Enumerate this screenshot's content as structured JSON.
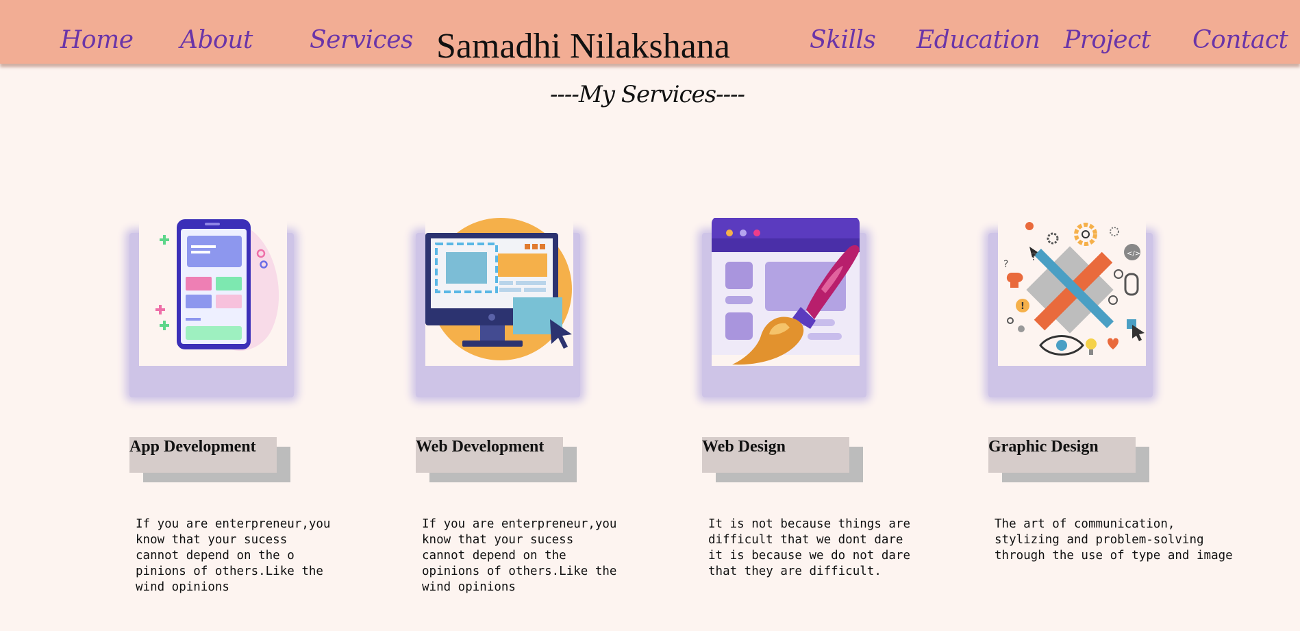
{
  "nav": {
    "brand": "Samadhi Nilakshana",
    "left_links": [
      "Home",
      "About",
      "Services"
    ],
    "right_links": [
      "Skills",
      "Education",
      "Project",
      "Contact"
    ]
  },
  "section_title": "----My Services----",
  "services": [
    {
      "title": "App Development",
      "image_icon": "mobile-app-illustration",
      "description": "If you are enterpreneur,you\nknow that your sucess\ncannot depend on the o\npinions of others.Like the\nwind opinions"
    },
    {
      "title": "Web Development",
      "image_icon": "desktop-monitor-illustration",
      "description": "If you are enterpreneur,you\nknow that your sucess\ncannot depend on the\nopinions of others.Like the\nwind opinions"
    },
    {
      "title": "Web Design",
      "image_icon": "paint-brush-browser-illustration",
      "description": "It is not because things are\ndifficult that we dont dare\nit is because we do not dare\nthat they are difficult."
    },
    {
      "title": "Graphic Design",
      "image_icon": "design-tools-illustration",
      "description": "The art of communication,\nstylizing and problem-solving\nthrough the use of type and image"
    }
  ],
  "colors": {
    "navbar": "#f2ad94",
    "nav_link": "#6a35a8",
    "page_bg": "#fdf4f0",
    "image_glow": "#cec4e7",
    "title_box": "#d6ccca",
    "title_shadow": "#bcbcbc"
  }
}
